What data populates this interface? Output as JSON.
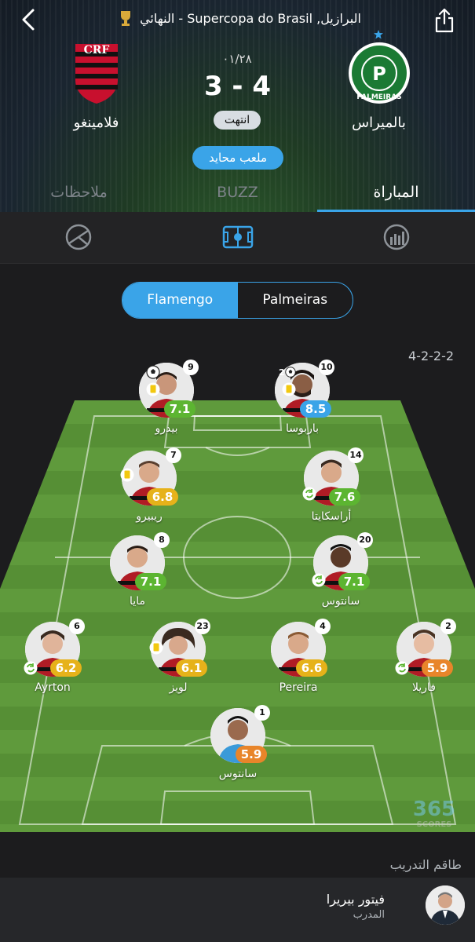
{
  "header": {
    "title": "البرازيل, Supercopa do Brasil - النهائي",
    "home_team": "بالميراس",
    "away_team": "فلامينغو",
    "date": "٠١/٢٨",
    "score": "3 - 4",
    "status": "انتهت",
    "venue_badge": "ملعب محايد",
    "palmeiras_logo_text": "PALMEIRAS"
  },
  "tabs": [
    {
      "label": "المباراة",
      "active": true
    },
    {
      "label": "BUZZ",
      "active": false
    },
    {
      "label": "ملاحظات",
      "active": false
    }
  ],
  "subnav": {
    "icons": [
      "stats-icon",
      "lineup-icon",
      "prediction-icon"
    ]
  },
  "lineup": {
    "toggle": {
      "left": "Flamengo",
      "right": "Palmeiras",
      "selected": "Flamengo"
    },
    "formation": "4-2-2-2",
    "players": [
      {
        "name": "بيدرو",
        "number": "9",
        "rating": "7.1",
        "rating_color": "#5cb531"
      },
      {
        "name": "باربوسا",
        "number": "10",
        "rating": "8.5",
        "rating_color": "#3aa4e8"
      },
      {
        "name": "ريبيرو",
        "number": "7",
        "rating": "6.8",
        "rating_color": "#e6b21a"
      },
      {
        "name": "أراسكايتا",
        "number": "14",
        "rating": "7.6",
        "rating_color": "#5cb531"
      },
      {
        "name": "مايا",
        "number": "8",
        "rating": "7.1",
        "rating_color": "#5cb531"
      },
      {
        "name": "سانتوس",
        "number": "20",
        "rating": "7.1",
        "rating_color": "#5cb531"
      },
      {
        "name": "Ayrton",
        "number": "6",
        "rating": "6.2",
        "rating_color": "#e6b21a"
      },
      {
        "name": "لويز",
        "number": "23",
        "rating": "6.1",
        "rating_color": "#e6b21a"
      },
      {
        "name": "Pereira",
        "number": "4",
        "rating": "6.6",
        "rating_color": "#e6b21a"
      },
      {
        "name": "فاريلا",
        "number": "2",
        "rating": "5.9",
        "rating_color": "#e8852a"
      },
      {
        "name": "سانتوس",
        "number": "1",
        "rating": "5.9",
        "rating_color": "#e8852a"
      }
    ],
    "goal_count_barbosa": "2"
  },
  "coach": {
    "section_title": "طاقم التدريب",
    "name": "فيتور بيريرا",
    "role": "المدرب"
  },
  "brand": {
    "line1": "365",
    "line2": "SCORES"
  }
}
